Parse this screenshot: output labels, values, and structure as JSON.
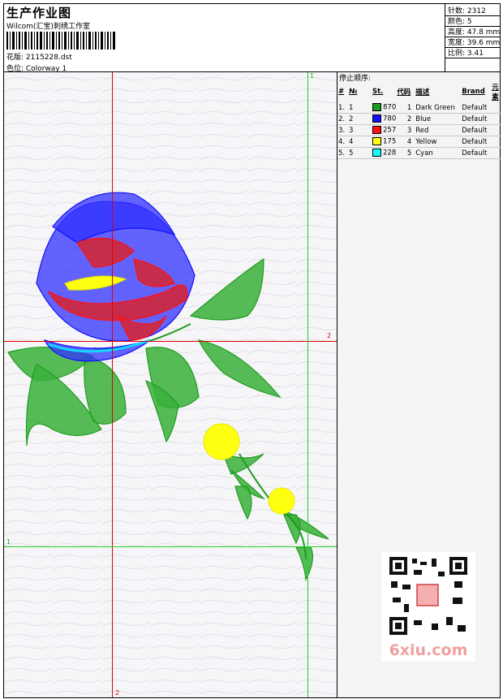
{
  "header": {
    "title": "生产作业图",
    "studio": "Wilcom(汇宝)刺绣工作室",
    "design_file": "花版: 2115228.dst",
    "colorway": "色位: Colorway 1"
  },
  "stats": {
    "stitches": "针数: 2312",
    "colors": "颜色: 5",
    "height": "高度: 47.8 mm",
    "width": "宽度: 39.6 mm",
    "scale": "比例: 3.41"
  },
  "panel": {
    "heading": "停止顺序:",
    "columns": [
      "#",
      "№",
      "St.",
      "代码",
      "描述",
      "Brand",
      "元素"
    ],
    "rows": [
      {
        "idx": "1.",
        "no": "1",
        "color": "#1e9c1e",
        "stitches": "870",
        "code": "1",
        "desc": "Dark Green",
        "brand": "Default"
      },
      {
        "idx": "2.",
        "no": "2",
        "color": "#1010ff",
        "stitches": "780",
        "code": "2",
        "desc": "Blue",
        "brand": "Default"
      },
      {
        "idx": "3.",
        "no": "3",
        "color": "#ff1010",
        "stitches": "257",
        "code": "3",
        "desc": "Red",
        "brand": "Default"
      },
      {
        "idx": "4.",
        "no": "4",
        "color": "#ffff10",
        "stitches": "175",
        "code": "4",
        "desc": "Yellow",
        "brand": "Default"
      },
      {
        "idx": "5.",
        "no": "5",
        "color": "#10ffff",
        "stitches": "228",
        "code": "5",
        "desc": "Cyan",
        "brand": "Default"
      }
    ]
  },
  "grid": {
    "label_1": "1",
    "label_2": "2"
  },
  "watermark": {
    "text": "6xiu.com"
  }
}
